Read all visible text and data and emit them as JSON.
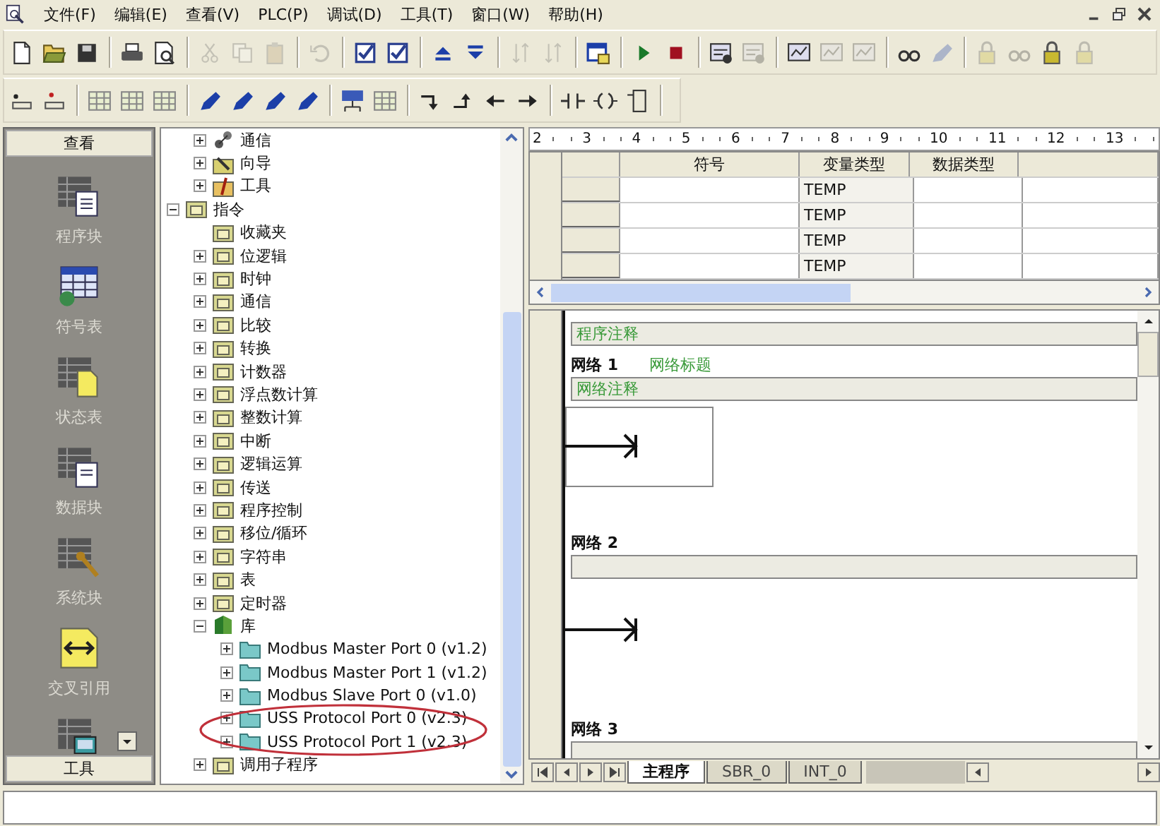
{
  "menu_bar": {
    "items": [
      "文件(F)",
      "编辑(E)",
      "查看(V)",
      "PLC(P)",
      "调试(D)",
      "工具(T)",
      "窗口(W)",
      "帮助(H)"
    ]
  },
  "toolbar_1": [
    [
      {
        "kind": "new",
        "disabled": false
      },
      {
        "kind": "open",
        "disabled": false
      },
      {
        "kind": "save",
        "disabled": false
      }
    ],
    [
      {
        "kind": "print",
        "disabled": false
      },
      {
        "kind": "preview",
        "disabled": false
      }
    ],
    [
      {
        "kind": "cut",
        "disabled": true
      },
      {
        "kind": "copy",
        "disabled": true
      },
      {
        "kind": "paste",
        "disabled": true
      }
    ],
    [
      {
        "kind": "undo",
        "disabled": true
      }
    ],
    [
      {
        "kind": "check",
        "disabled": false
      },
      {
        "kind": "check",
        "disabled": false
      }
    ],
    [
      {
        "kind": "upload",
        "disabled": false
      },
      {
        "kind": "download",
        "disabled": false
      }
    ],
    [
      {
        "kind": "sort",
        "disabled": true
      },
      {
        "kind": "sort",
        "disabled": true
      }
    ],
    [
      {
        "kind": "window",
        "disabled": false
      }
    ],
    [
      {
        "kind": "run",
        "disabled": false
      },
      {
        "kind": "stop",
        "disabled": false
      }
    ],
    [
      {
        "kind": "monitor",
        "disabled": false
      },
      {
        "kind": "monitor",
        "disabled": true
      }
    ],
    [
      {
        "kind": "chart",
        "disabled": false
      },
      {
        "kind": "chart",
        "disabled": true
      },
      {
        "kind": "chart",
        "disabled": true
      }
    ],
    [
      {
        "kind": "glasses",
        "disabled": false
      },
      {
        "kind": "pencil",
        "disabled": true
      }
    ],
    [
      {
        "kind": "lock",
        "disabled": true
      },
      {
        "kind": "glasses",
        "disabled": true
      },
      {
        "kind": "lock",
        "disabled": false
      },
      {
        "kind": "lock",
        "disabled": true
      }
    ]
  ],
  "toolbar_2": [
    [
      {
        "kind": "bit",
        "disabled": false
      },
      {
        "kind": "bit-red",
        "disabled": false
      }
    ],
    [
      {
        "kind": "grid",
        "disabled": false
      },
      {
        "kind": "grid",
        "disabled": false
      },
      {
        "kind": "grid",
        "disabled": false
      }
    ],
    [
      {
        "kind": "pencil",
        "disabled": false
      },
      {
        "kind": "pencil",
        "disabled": false
      },
      {
        "kind": "pencil",
        "disabled": false
      },
      {
        "kind": "pencil",
        "disabled": false
      }
    ],
    [
      {
        "kind": "network",
        "disabled": false
      },
      {
        "kind": "grid",
        "disabled": false
      }
    ],
    [
      {
        "kind": "line-down",
        "disabled": false
      },
      {
        "kind": "line-up",
        "disabled": false
      },
      {
        "kind": "arrow-left",
        "disabled": false
      },
      {
        "kind": "arrow-right",
        "disabled": false
      }
    ],
    [
      {
        "kind": "contact",
        "disabled": false
      },
      {
        "kind": "coil",
        "disabled": false
      },
      {
        "kind": "box",
        "disabled": false
      }
    ]
  ],
  "navigation_bar": {
    "title": "查看",
    "footer": "工具",
    "items": [
      {
        "kind": "program",
        "label": "程序块"
      },
      {
        "kind": "symbol",
        "label": "符号表"
      },
      {
        "kind": "status",
        "label": "状态表"
      },
      {
        "kind": "data",
        "label": "数据块"
      },
      {
        "kind": "system",
        "label": "系统块"
      },
      {
        "kind": "xref",
        "label": "交叉引用"
      },
      {
        "kind": "comm"
      }
    ]
  },
  "tree": {
    "items": [
      {
        "children": [
          {
            "kind": "network",
            "label": "通信",
            "expanded": false
          },
          {
            "kind": "wizard",
            "label": "向导",
            "expanded": false
          },
          {
            "kind": "tool",
            "label": "工具",
            "expanded": false
          }
        ]
      },
      {
        "kind": "folder",
        "label": "指令",
        "expanded": true,
        "children": [
          {
            "kind": "folder",
            "label": "收藏夹"
          },
          {
            "kind": "folder",
            "label": "位逻辑",
            "expanded": false
          },
          {
            "kind": "folder",
            "label": "时钟",
            "expanded": false
          },
          {
            "kind": "folder",
            "label": "通信",
            "expanded": false
          },
          {
            "kind": "folder",
            "label": "比较",
            "expanded": false
          },
          {
            "kind": "folder",
            "label": "转换",
            "expanded": false
          },
          {
            "kind": "folder",
            "label": "计数器",
            "expanded": false
          },
          {
            "kind": "folder",
            "label": "浮点数计算",
            "expanded": false
          },
          {
            "kind": "folder",
            "label": "整数计算",
            "expanded": false
          },
          {
            "kind": "folder",
            "label": "中断",
            "expanded": false
          },
          {
            "kind": "folder",
            "label": "逻辑运算",
            "expanded": false
          },
          {
            "kind": "folder",
            "label": "传送",
            "expanded": false
          },
          {
            "kind": "folder",
            "label": "程序控制",
            "expanded": false
          },
          {
            "kind": "folder",
            "label": "移位/循环",
            "expanded": false
          },
          {
            "kind": "folder",
            "label": "字符串",
            "expanded": false
          },
          {
            "kind": "folder",
            "label": "表",
            "expanded": false
          },
          {
            "kind": "folder",
            "label": "定时器",
            "expanded": false
          },
          {
            "kind": "library",
            "label": "库",
            "expanded": true,
            "children": [
              {
                "kind": "teal-folder",
                "label": "Modbus Master Port 0 (v1.2)",
                "expanded": false
              },
              {
                "kind": "teal-folder",
                "label": "Modbus Master Port 1 (v1.2)",
                "expanded": false
              },
              {
                "kind": "teal-folder",
                "label": "Modbus Slave Port 0 (v1.0)",
                "expanded": false
              },
              {
                "kind": "teal-folder",
                "label": "USS Protocol Port 0 (v2.3)",
                "expanded": false
              },
              {
                "kind": "teal-folder",
                "label": "USS Protocol Port 1 (v2.3)",
                "expanded": false
              }
            ]
          },
          {
            "kind": "folder",
            "label": "调用子程序",
            "expanded": false
          }
        ]
      }
    ]
  },
  "ruler": [
    "2",
    "3",
    "4",
    "5",
    "6",
    "7",
    "8",
    "9",
    "10",
    "11",
    "12",
    "13"
  ],
  "variable_table": {
    "columns": [
      "符号",
      "变量类型",
      "数据类型"
    ],
    "rows": [
      {
        "variable_type": "TEMP"
      },
      {
        "variable_type": "TEMP"
      },
      {
        "variable_type": "TEMP"
      },
      {
        "variable_type": "TEMP"
      }
    ]
  },
  "editor": {
    "program_comment": "程序注释",
    "networks": [
      {
        "label": "网络 1",
        "title": "网络标题",
        "comment": "网络注释",
        "kind": "boxed"
      },
      {
        "label": "网络 2",
        "kind": "open"
      },
      {
        "label": "网络 3"
      }
    ]
  },
  "tabs": [
    {
      "label": "主程序",
      "selected": true
    },
    {
      "label": "SBR_0",
      "selected": false
    },
    {
      "label": "INT_0",
      "selected": false
    }
  ]
}
